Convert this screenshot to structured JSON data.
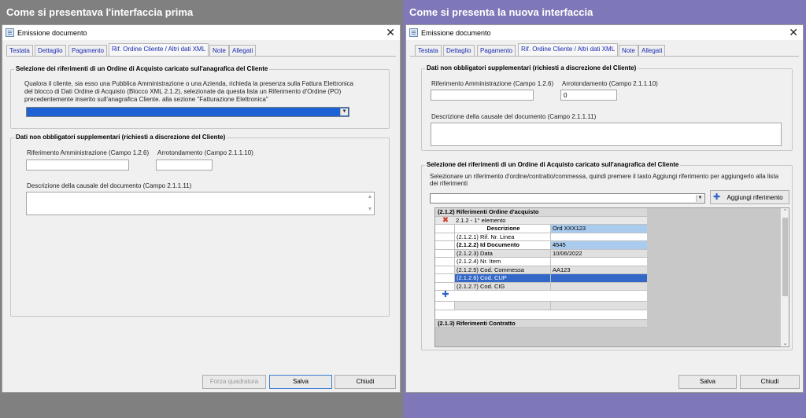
{
  "left": {
    "caption": "Come si presentava l'interfaccia prima",
    "window_title": "Emissione documento",
    "tabs": [
      "Testata",
      "Dettaglio",
      "Pagamento",
      "Rif. Ordine Cliente / Altri dati XML",
      "Note",
      "Allegati"
    ],
    "group1_title": "Selezione dei riferimenti di un Ordine di Acquisto caricato sull'anagrafica del Cliente",
    "group1_text": [
      "Qualora il cliente, sia esso una Pubblica Amministrazione o una Azienda, richieda la presenza sulla Fattura Elettronica",
      "del blocco di Dati Ordine di  Acquisto (Blocco XML 2.1.2), selezionate da questa lista un Riferimento d'Ordine (PO)",
      "precedentemente inserito sull'anagrafica Cliente. alla sezione \"Fatturazione Elettronica\""
    ],
    "group2_title": "Dati non obbligatori supplementari (richiesti a discrezione del Cliente)",
    "rif_amm_label": "Riferimento Amministrazione (Campo 1.2.6)",
    "arrot_label": "Arrotondamento (Campo 2.1.1.10)",
    "causale_label": "Descrizione della causale del documento (Campo 2.1.1.11)",
    "buttons": {
      "forza": "Forza quadratura",
      "salva": "Salva",
      "chiudi": "Chiudi"
    }
  },
  "right": {
    "caption": "Come si presenta la nuova interfaccia",
    "window_title": "Emissione documento",
    "tabs": [
      "Testata",
      "Dettaglio",
      "Pagamento",
      "Rif. Ordine Cliente / Altri dati XML",
      "Note",
      "Allegati"
    ],
    "group1_title": "Dati non obbligatori supplementari (richiesti a discrezione del Cliente)",
    "rif_amm_label": "Riferimento Amministrazione (Campo 1.2.6)",
    "arrot_label": "Arrotondamento (Campo 2.1.1.10)",
    "arrot_value": "0",
    "causale_label": "Descrizione della causale del documento (Campo 2.1.1.11)",
    "group2_title": "Selezione dei riferimenti di un Ordine di Acquisto caricato sull'anagrafica del Cliente",
    "group2_text": [
      "Selezionare un riferimento d'ordine/contratto/commessa, quindi premere il tasto Aggiungi riferimento per aggiungerlo alla lista",
      "dei riferimenti"
    ],
    "add_ref_label": "Aggiungi riferimento",
    "grid": {
      "section1": "(2.1.2) Riferimenti Ordine d'acquisto",
      "element": "2.1.2 - 1° elemento",
      "header_label": "Descrizione",
      "header_value": "Ord XXX123",
      "rows": [
        {
          "label": "(2.1.2.1) Rif. Nr. Linea",
          "value": ""
        },
        {
          "label": "(2.1.2.2) Id Documento",
          "value": "4545"
        },
        {
          "label": "(2.1.2.3) Data",
          "value": "10/06/2022"
        },
        {
          "label": "(2.1.2.4) Nr. Item",
          "value": ""
        },
        {
          "label": "(2.1.2.5) Cod. Commessa",
          "value": "AA123"
        },
        {
          "label": "(2.1.2.6) Cod. CUP",
          "value": ""
        },
        {
          "label": "(2.1.2.7) Cod. CIG",
          "value": ""
        }
      ],
      "section2": "(2.1.3) Riferimenti Contratto"
    },
    "buttons": {
      "salva": "Salva",
      "chiudi": "Chiudi"
    }
  }
}
